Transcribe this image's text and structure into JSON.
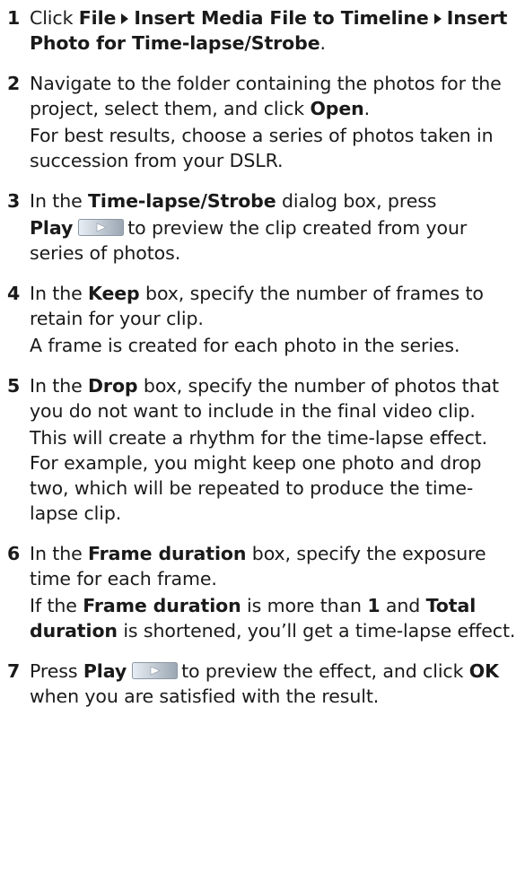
{
  "steps": [
    {
      "number": "1",
      "lines": [
        [
          {
            "t": "Click ",
            "b": false
          },
          {
            "t": "File",
            "b": true
          },
          {
            "sep": true
          },
          {
            "t": "Insert Media File to Timeline",
            "b": true
          },
          {
            "sep": true
          },
          {
            "t": "Insert Photo for Time-lapse/Strobe",
            "b": true
          },
          {
            "t": ".",
            "b": false
          }
        ]
      ]
    },
    {
      "number": "2",
      "lines": [
        [
          {
            "t": "Navigate to the folder containing the photos for the project, select them, and click ",
            "b": false
          },
          {
            "t": "Open",
            "b": true
          },
          {
            "t": ".",
            "b": false
          }
        ],
        [
          {
            "t": "For best results, choose a series of photos taken in succession from your DSLR.",
            "b": false
          }
        ]
      ]
    },
    {
      "number": "3",
      "lines": [
        [
          {
            "t": "In the ",
            "b": false
          },
          {
            "t": "Time-lapse/Strobe",
            "b": true
          },
          {
            "t": " dialog box, press",
            "b": false
          }
        ],
        [
          {
            "t": "Play",
            "b": true
          },
          {
            "icon": "play-button-icon"
          },
          {
            "t": "to preview the clip created from your series of photos.",
            "b": false
          }
        ]
      ]
    },
    {
      "number": "4",
      "lines": [
        [
          {
            "t": "In the ",
            "b": false
          },
          {
            "t": "Keep",
            "b": true
          },
          {
            "t": " box, specify the number of frames to retain for your clip.",
            "b": false
          }
        ],
        [
          {
            "t": "A frame is created for each photo in the series.",
            "b": false
          }
        ]
      ]
    },
    {
      "number": "5",
      "lines": [
        [
          {
            "t": "In the ",
            "b": false
          },
          {
            "t": "Drop",
            "b": true
          },
          {
            "t": " box, specify the number of photos that you do not want to include in the final video clip.",
            "b": false
          }
        ],
        [
          {
            "t": "This will create a rhythm for the time-lapse effect. For example, you might keep one photo and drop two, which will be repeated to produce the time-lapse clip.",
            "b": false
          }
        ]
      ]
    },
    {
      "number": "6",
      "lines": [
        [
          {
            "t": "In the ",
            "b": false
          },
          {
            "t": "Frame duration",
            "b": true
          },
          {
            "t": " box, specify the exposure time for each frame.",
            "b": false
          }
        ],
        [
          {
            "t": "If the ",
            "b": false
          },
          {
            "t": "Frame duration",
            "b": true
          },
          {
            "t": " is more than ",
            "b": false
          },
          {
            "t": "1",
            "b": true
          },
          {
            "t": " and ",
            "b": false
          },
          {
            "t": "Total duration",
            "b": true
          },
          {
            "t": " is shortened, you’ll get a time-lapse effect.",
            "b": false
          }
        ]
      ]
    },
    {
      "number": "7",
      "lines": [
        [
          {
            "t": "Press ",
            "b": false
          },
          {
            "t": "Play",
            "b": true
          },
          {
            "icon": "play-button-icon"
          },
          {
            "t": "to preview the effect, and click ",
            "b": false
          },
          {
            "t": "OK",
            "b": true
          },
          {
            "t": " when you are satisfied with the result.",
            "b": false
          }
        ]
      ]
    }
  ],
  "colors": {
    "text": "#1a1a1a",
    "button_light": "#e8eef5",
    "button_dark": "#9aa6b2",
    "button_arrow": "#ffffff"
  }
}
